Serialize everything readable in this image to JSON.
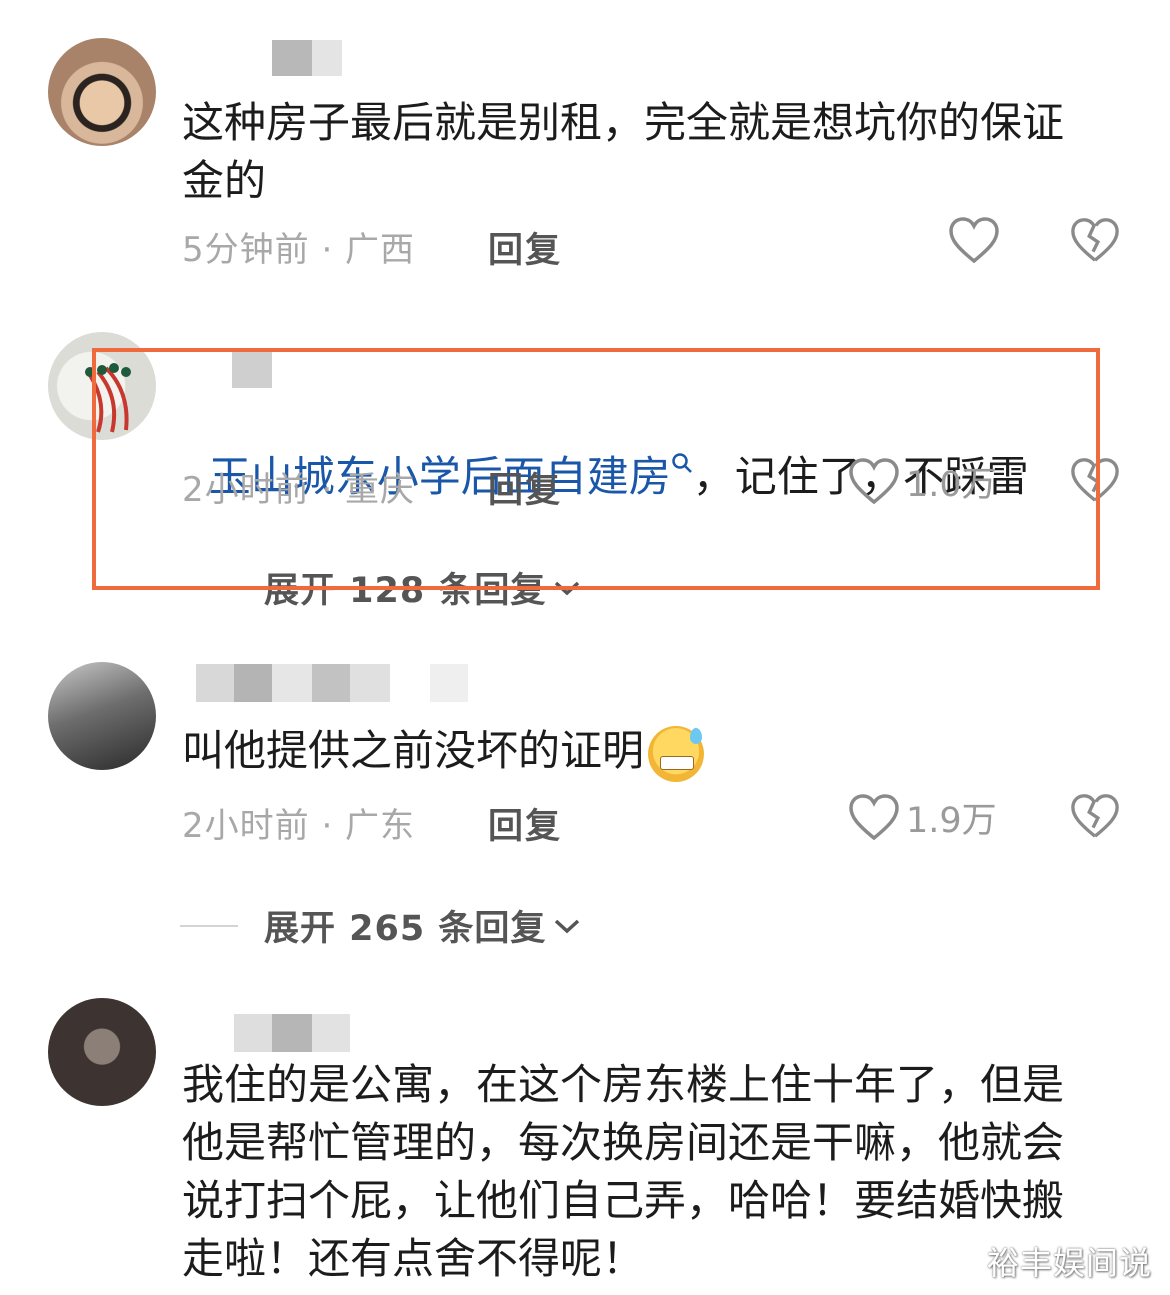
{
  "comments": [
    {
      "text": "这种房子最后就是别租，完全就是想坑你的保证金的",
      "meta": "5分钟前 · 广西",
      "reply_label": "回复",
      "likes": ""
    },
    {
      "link_text": "玉山城东小学后面自建房",
      "text_after_link": "，记住了，不踩雷",
      "meta": "2小时前 · 重庆",
      "reply_label": "回复",
      "likes": "1.0万",
      "expand_label": "展开 128 条回复"
    },
    {
      "text": "叫他提供之前没坏的证明",
      "meta": "2小时前 · 广东",
      "reply_label": "回复",
      "likes": "1.9万",
      "expand_label": "展开 265 条回复"
    },
    {
      "text": "我住的是公寓，在这个房东楼上住十年了，但是他是帮忙管理的，每次换房间还是干嘛，他就会说打扫个屁，让他们自己弄，哈哈！要结婚快搬走啦！还有点舍不得呢！"
    }
  ],
  "watermark": "裕丰娱间说",
  "colors": {
    "highlight": "#ef6a3c",
    "link": "#1a57a8"
  }
}
